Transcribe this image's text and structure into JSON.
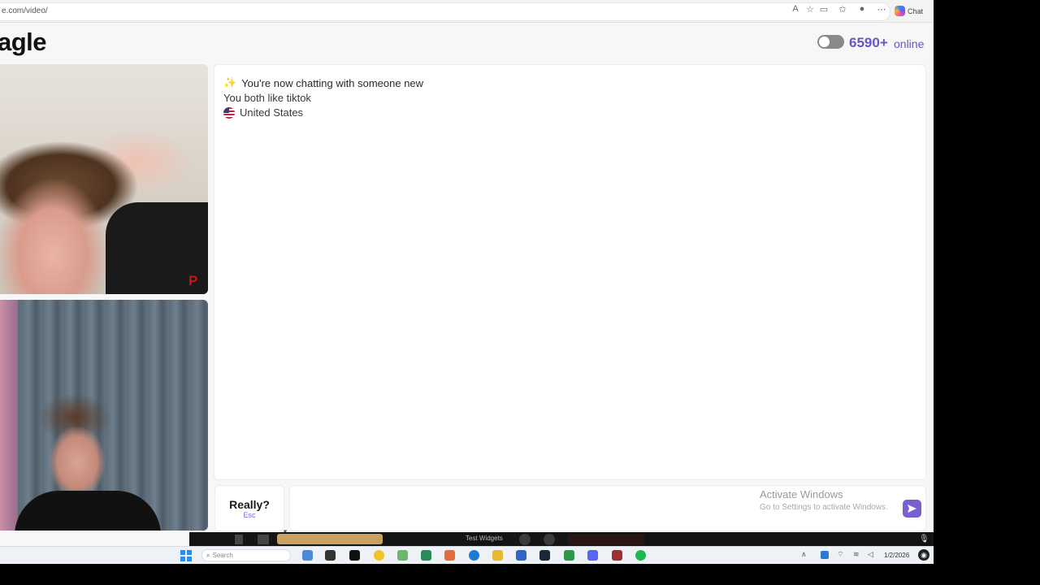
{
  "browser": {
    "url": "e.com/video/",
    "chat_label": "Chat"
  },
  "header": {
    "logo": "agle",
    "online_count": "6590+",
    "online_label": "online"
  },
  "video": {
    "report_glyph": "P"
  },
  "chat": {
    "line1": "You're now chatting with someone new",
    "line2": "You both like tiktok",
    "line3": "United States"
  },
  "input": {
    "skip_label": "Really?",
    "skip_hint": "Esc",
    "activate_title": "Activate Windows",
    "activate_sub": "Go to Settings to activate Windows."
  },
  "share_bar": {
    "widgets_label": "Test Widgets"
  },
  "taskbar": {
    "search_placeholder": "Search",
    "date": "1/2/2026"
  },
  "colors": {
    "accent": "#6a52c8",
    "send_button": "#7a5fd0",
    "report": "#c0161d"
  }
}
